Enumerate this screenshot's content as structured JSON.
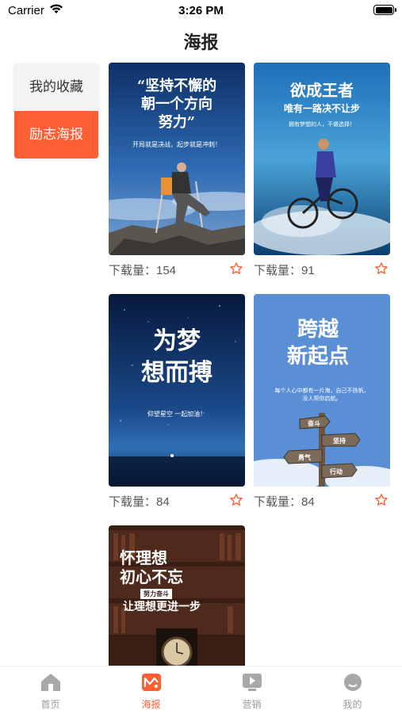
{
  "status_bar": {
    "carrier": "Carrier",
    "time": "3:26 PM"
  },
  "header": {
    "title": "海报"
  },
  "sidebar": {
    "items": [
      {
        "label": "我的收藏",
        "active": false
      },
      {
        "label": "励志海报",
        "active": true
      }
    ]
  },
  "posters": [
    {
      "title_lines": [
        "“坚持不懈的",
        "朝一个方向",
        "努力”"
      ],
      "subtitle": "开局就是决战，起步就是冲刺！",
      "download_label": "下载量：154"
    },
    {
      "title_lines": [
        "欲成王者",
        "唯有一路决不让步"
      ],
      "subtitle": "拥有梦想的人，不做选择！",
      "download_label": "下载量：91"
    },
    {
      "title_lines": [
        "为梦",
        "想而搏"
      ],
      "subtitle": "仰望星空 一起加油！",
      "download_label": "下载量：84"
    },
    {
      "title_lines": [
        "跨越",
        "新起点"
      ],
      "subtitle": "每个人心中都有一片海，自己不扬帆，没人帮你启航。",
      "sign_lines": [
        "奋斗",
        "坚持",
        "勇气",
        "行动"
      ],
      "download_label": "下载量：84"
    },
    {
      "title_lines": [
        "怀理想",
        "初心不忘",
        "让理想更进一步"
      ],
      "badge": "努力奋斗",
      "download_label": ""
    }
  ],
  "tabbar": {
    "items": [
      {
        "label": "首页",
        "icon": "home-icon",
        "active": false
      },
      {
        "label": "海报",
        "icon": "poster-icon",
        "active": true
      },
      {
        "label": "营销",
        "icon": "play-icon",
        "active": false
      },
      {
        "label": "我的",
        "icon": "profile-icon",
        "active": false
      }
    ]
  },
  "colors": {
    "accent": "#fb5f33",
    "inactive": "#999999",
    "star": "#fb5f33"
  }
}
